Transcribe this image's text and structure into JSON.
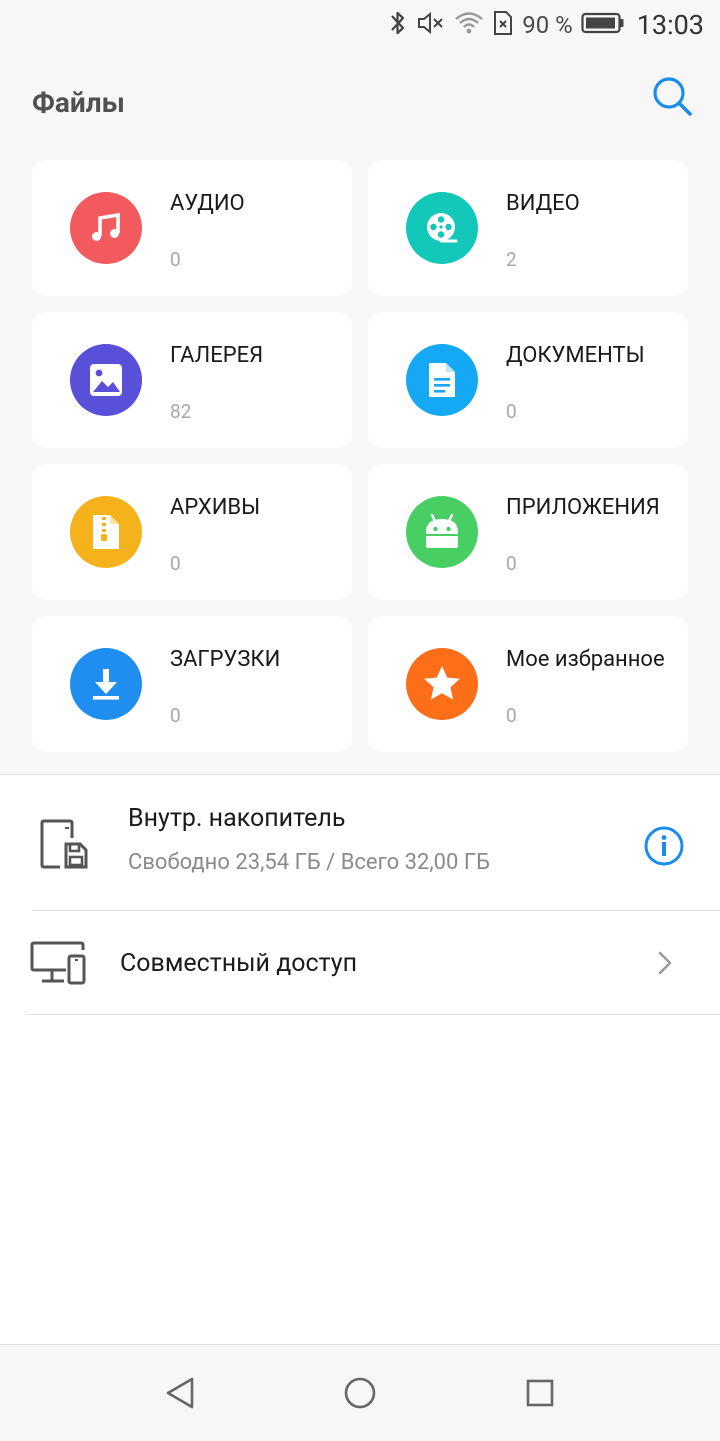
{
  "status_bar": {
    "battery_text": "90 %",
    "time": "13:03",
    "icons": [
      "bluetooth-icon",
      "mute-icon",
      "wifi-icon",
      "no-sim-icon",
      "battery-icon"
    ]
  },
  "header": {
    "title": "Файлы",
    "search_icon": "search-icon",
    "accent_color": "#1a8cf0"
  },
  "categories": [
    {
      "label": "АУДИО",
      "count": "0",
      "icon": "music-note-icon",
      "color": "#f25a5e"
    },
    {
      "label": "ВИДЕО",
      "count": "2",
      "icon": "film-reel-icon",
      "color": "#13c7b9"
    },
    {
      "label": "ГАЛЕРЕЯ",
      "count": "82",
      "icon": "image-icon",
      "color": "#5a4fd8"
    },
    {
      "label": "ДОКУМЕНТЫ",
      "count": "0",
      "icon": "document-icon",
      "color": "#14a8f5"
    },
    {
      "label": "АРХИВЫ",
      "count": "0",
      "icon": "zip-file-icon",
      "color": "#f6b21b"
    },
    {
      "label": "ПРИЛОЖЕНИЯ",
      "count": "0",
      "icon": "android-icon",
      "color": "#47cf63"
    },
    {
      "label": "ЗАГРУЗКИ",
      "count": "0",
      "icon": "download-icon",
      "color": "#1e8ff0"
    },
    {
      "label": "Мое избранное",
      "count": "0",
      "icon": "star-icon",
      "color": "#fc6f18"
    }
  ],
  "storage": {
    "title": "Внутр. накопитель",
    "subtitle": "Свободно 23,54 ГБ / Всего 32,00 ГБ",
    "icon": "phone-storage-icon",
    "info_icon": "info-icon"
  },
  "share": {
    "title": "Совместный доступ",
    "icon": "devices-icon",
    "chevron_icon": "chevron-right-icon"
  },
  "nav_bar": {
    "icons": [
      "back-icon",
      "home-icon",
      "recents-icon"
    ]
  }
}
